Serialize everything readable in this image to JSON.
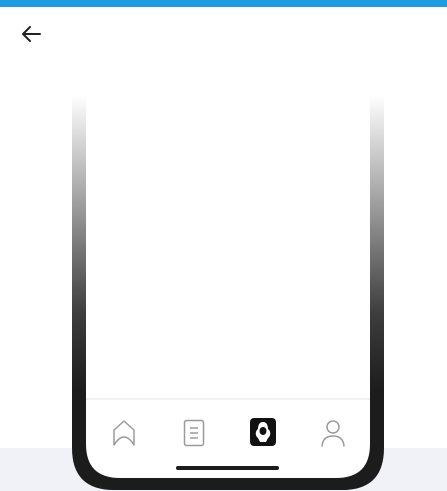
{
  "header": {
    "back_icon": "arrow-left-icon",
    "accent_color": "#1a9be2"
  },
  "phone_mockup": {
    "frame_color": "#1c1c1c",
    "screen_color": "#ffffff",
    "tab_bar": {
      "items": [
        {
          "icon": "home-icon",
          "active": false
        },
        {
          "icon": "document-icon",
          "active": false
        },
        {
          "icon": "app-logo-icon",
          "active": true
        },
        {
          "icon": "profile-icon",
          "active": false
        }
      ]
    }
  },
  "footer": {
    "band_color": "#f1f1f8"
  }
}
